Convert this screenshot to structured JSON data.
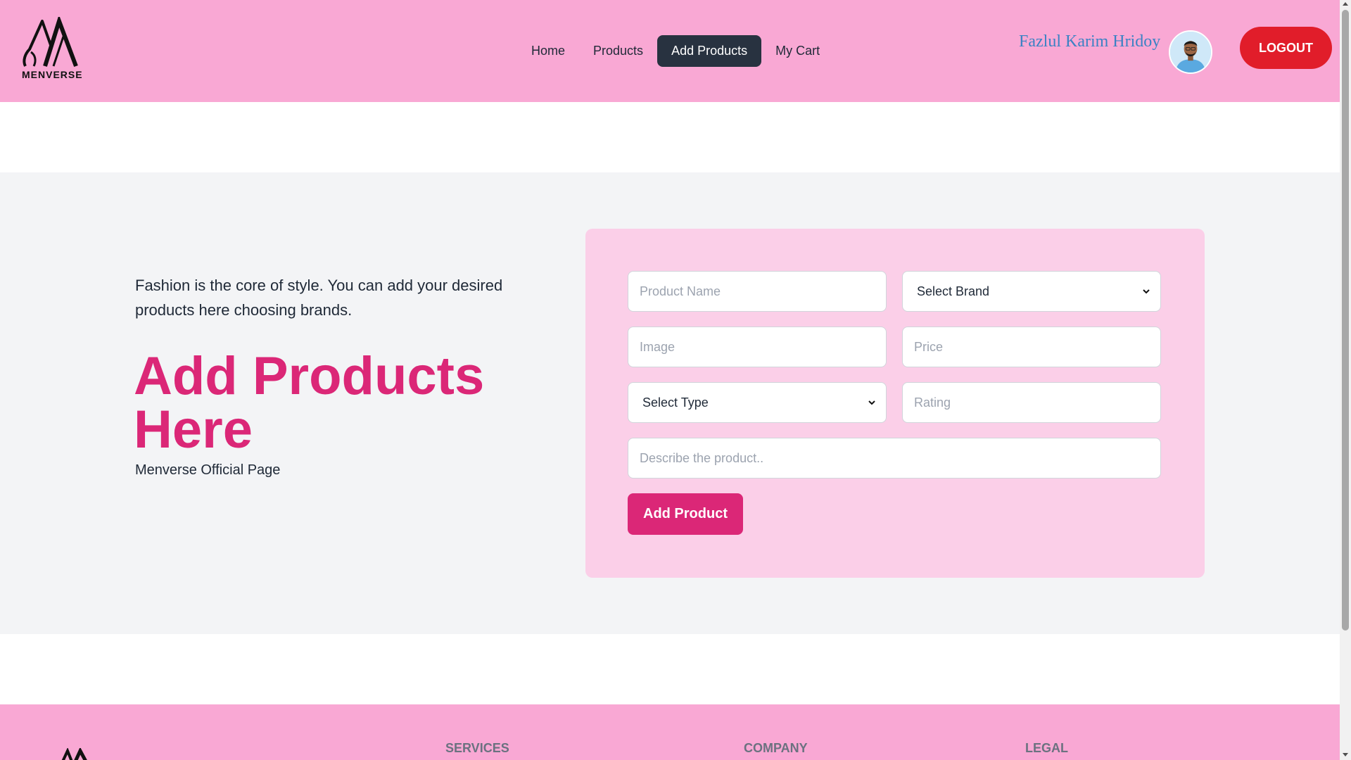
{
  "header": {
    "logo_text": "MENVERSE",
    "nav": [
      {
        "label": "Home"
      },
      {
        "label": "Products"
      },
      {
        "label": "Add Products"
      },
      {
        "label": "My Cart"
      }
    ],
    "active_nav": "Add Products",
    "user_name": "Fazlul Karim Hridoy",
    "logout_label": "LOGOUT"
  },
  "main": {
    "intro": "Fashion is the core of style. You can add your desired products here choosing brands.",
    "title": "Add Products Here",
    "subtitle": "Menverse Official Page",
    "form": {
      "product_name_placeholder": "Product Name",
      "brand_select_value": "Select Brand",
      "image_placeholder": "Image",
      "price_placeholder": "Price",
      "type_select_value": "Select Type",
      "rating_placeholder": "Rating",
      "description_placeholder": "Describe the product..",
      "submit_label": "Add Product"
    }
  },
  "footer": {
    "headings": [
      "SERVICES",
      "COMPANY",
      "LEGAL"
    ]
  },
  "colors": {
    "header_bg": "#f9a8d4",
    "accent_pink": "#db2777",
    "form_bg": "#fbcfe8",
    "active_nav_bg": "#283240",
    "logout_bg": "#e11d2a",
    "user_name": "#3b82c4"
  },
  "icons": {
    "logo": "menverse-logo-icon",
    "avatar": "user-avatar",
    "select_arrow": "chevron-down-icon"
  }
}
